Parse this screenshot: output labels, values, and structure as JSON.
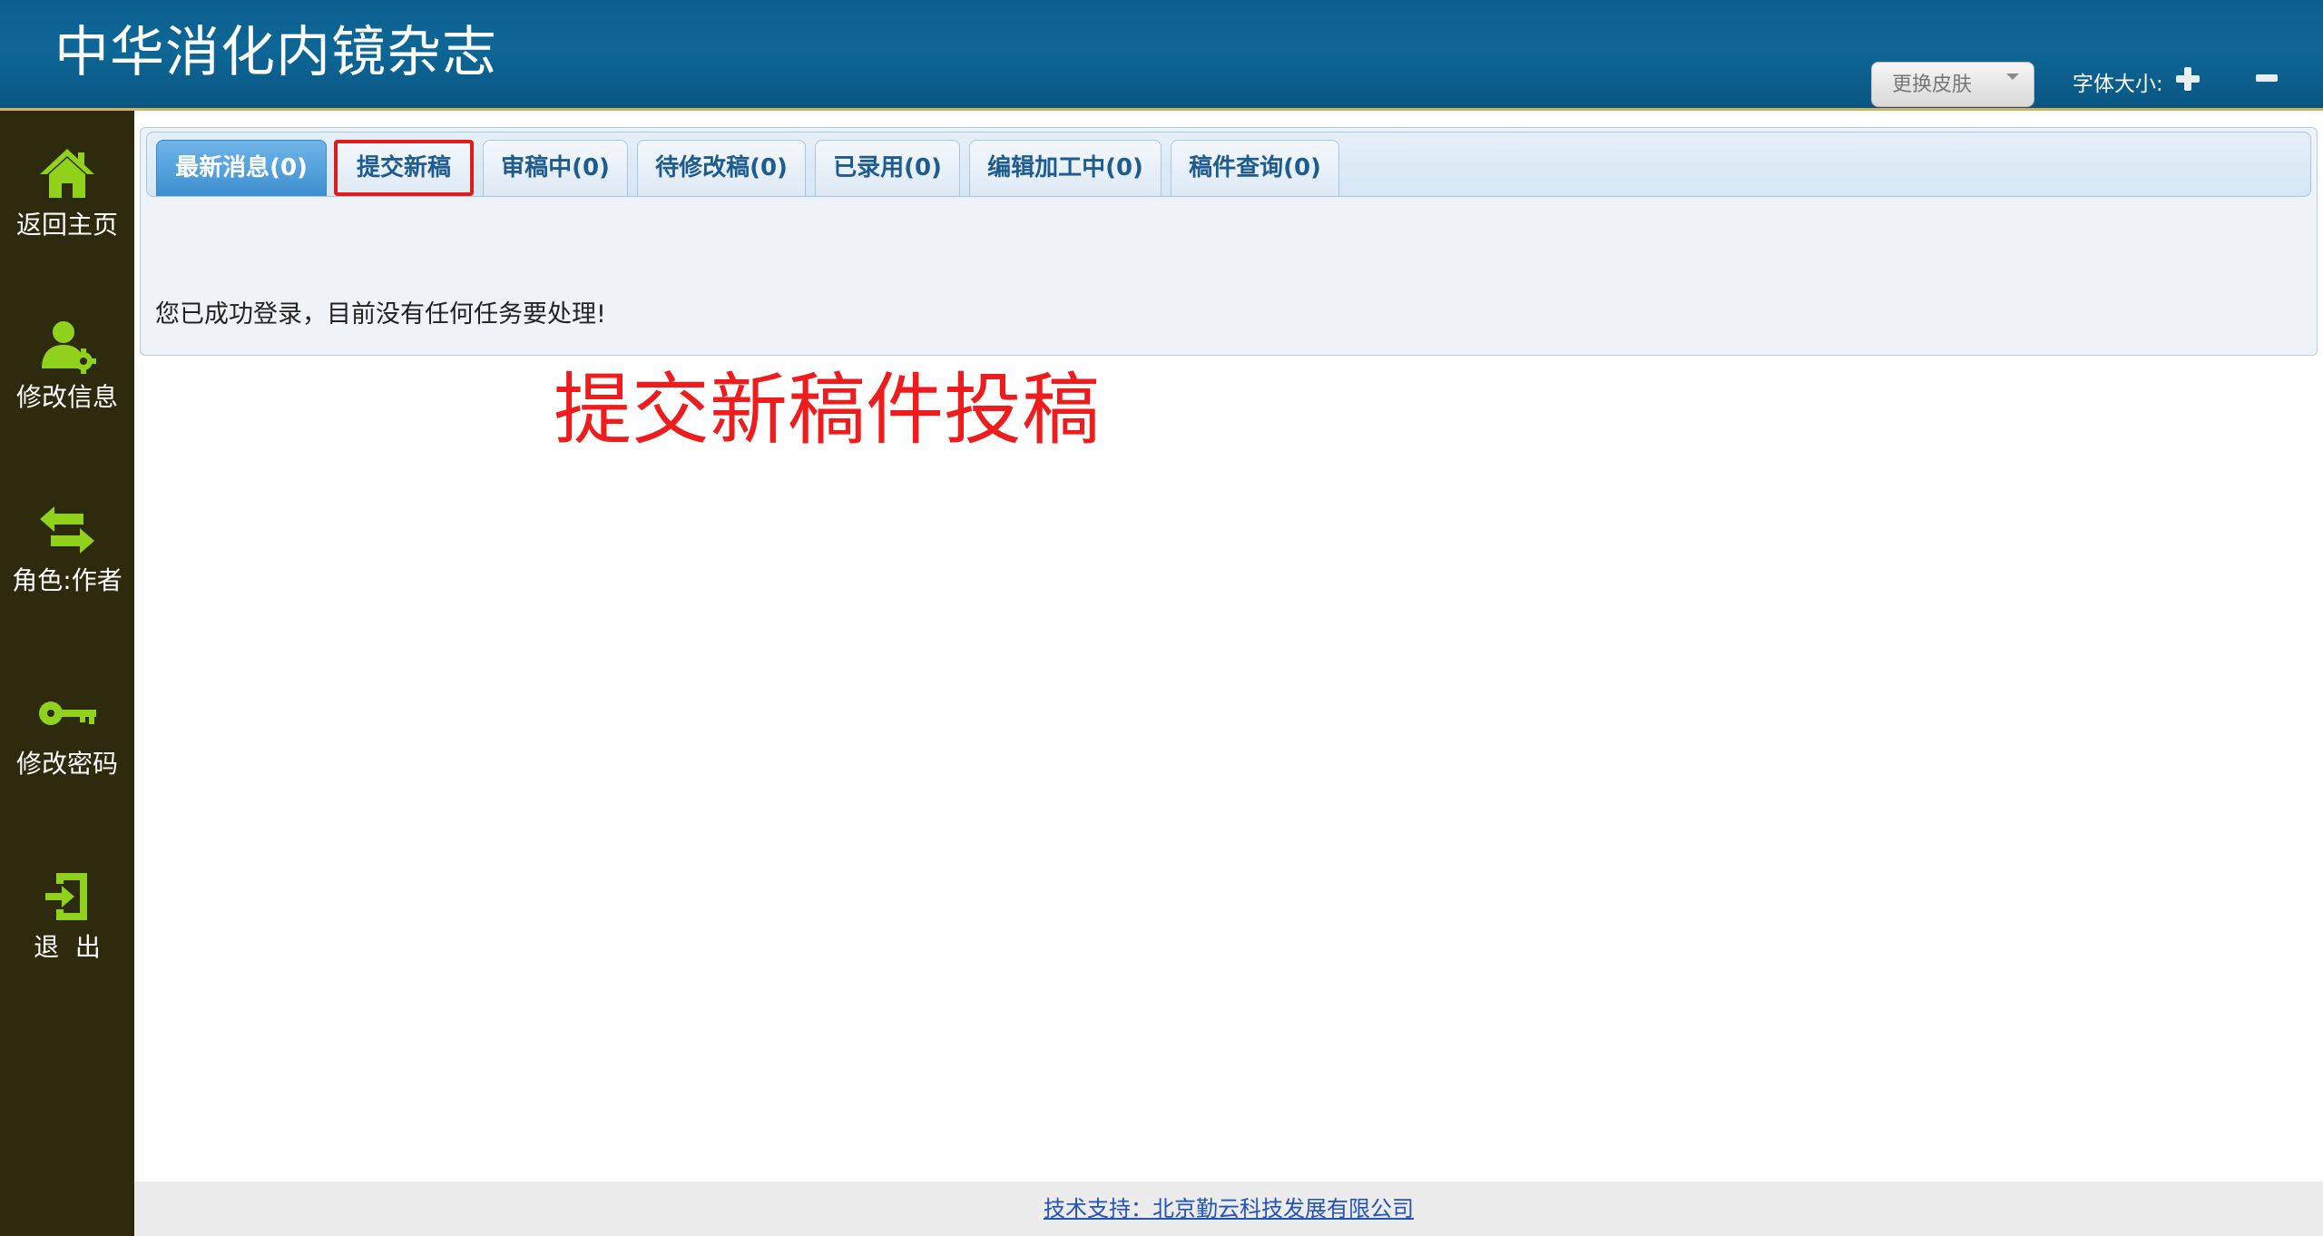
{
  "header": {
    "title": "中华消化内镜杂志",
    "skin_button_label": "更换皮肤",
    "font_size_label": "字体大小:"
  },
  "sidebar": {
    "items": [
      {
        "label": "返回主页",
        "icon": "home-icon"
      },
      {
        "label": "修改信息",
        "icon": "user-settings-icon"
      },
      {
        "label": "角色:作者",
        "icon": "switch-arrows-icon"
      },
      {
        "label": "修改密码",
        "icon": "key-icon"
      },
      {
        "label": "退  出",
        "icon": "logout-icon"
      }
    ]
  },
  "tabs": [
    {
      "label": "最新消息(0)",
      "active": true
    },
    {
      "label": "提交新稿",
      "highlighted": true
    },
    {
      "label": "审稿中(0)"
    },
    {
      "label": "待修改稿(0)"
    },
    {
      "label": "已录用(0)"
    },
    {
      "label": "编辑加工中(0)"
    },
    {
      "label": "稿件查询(0)"
    }
  ],
  "main": {
    "status_message": "您已成功登录，目前没有任何任务要处理!"
  },
  "annotation": {
    "text": "提交新稿件投稿",
    "color": "#ee1c1c"
  },
  "footer": {
    "link_text": "技术支持：北京勤云科技发展有限公司"
  },
  "colors": {
    "header_bg": "#0d6796",
    "sidebar_bg": "#2e2a0e",
    "sidebar_icon": "#8fd11b",
    "tab_active": "#3d8fd0",
    "tab_text": "#1e5b8e",
    "highlight_border": "#e01b1b",
    "footer_link": "#2352b9"
  }
}
